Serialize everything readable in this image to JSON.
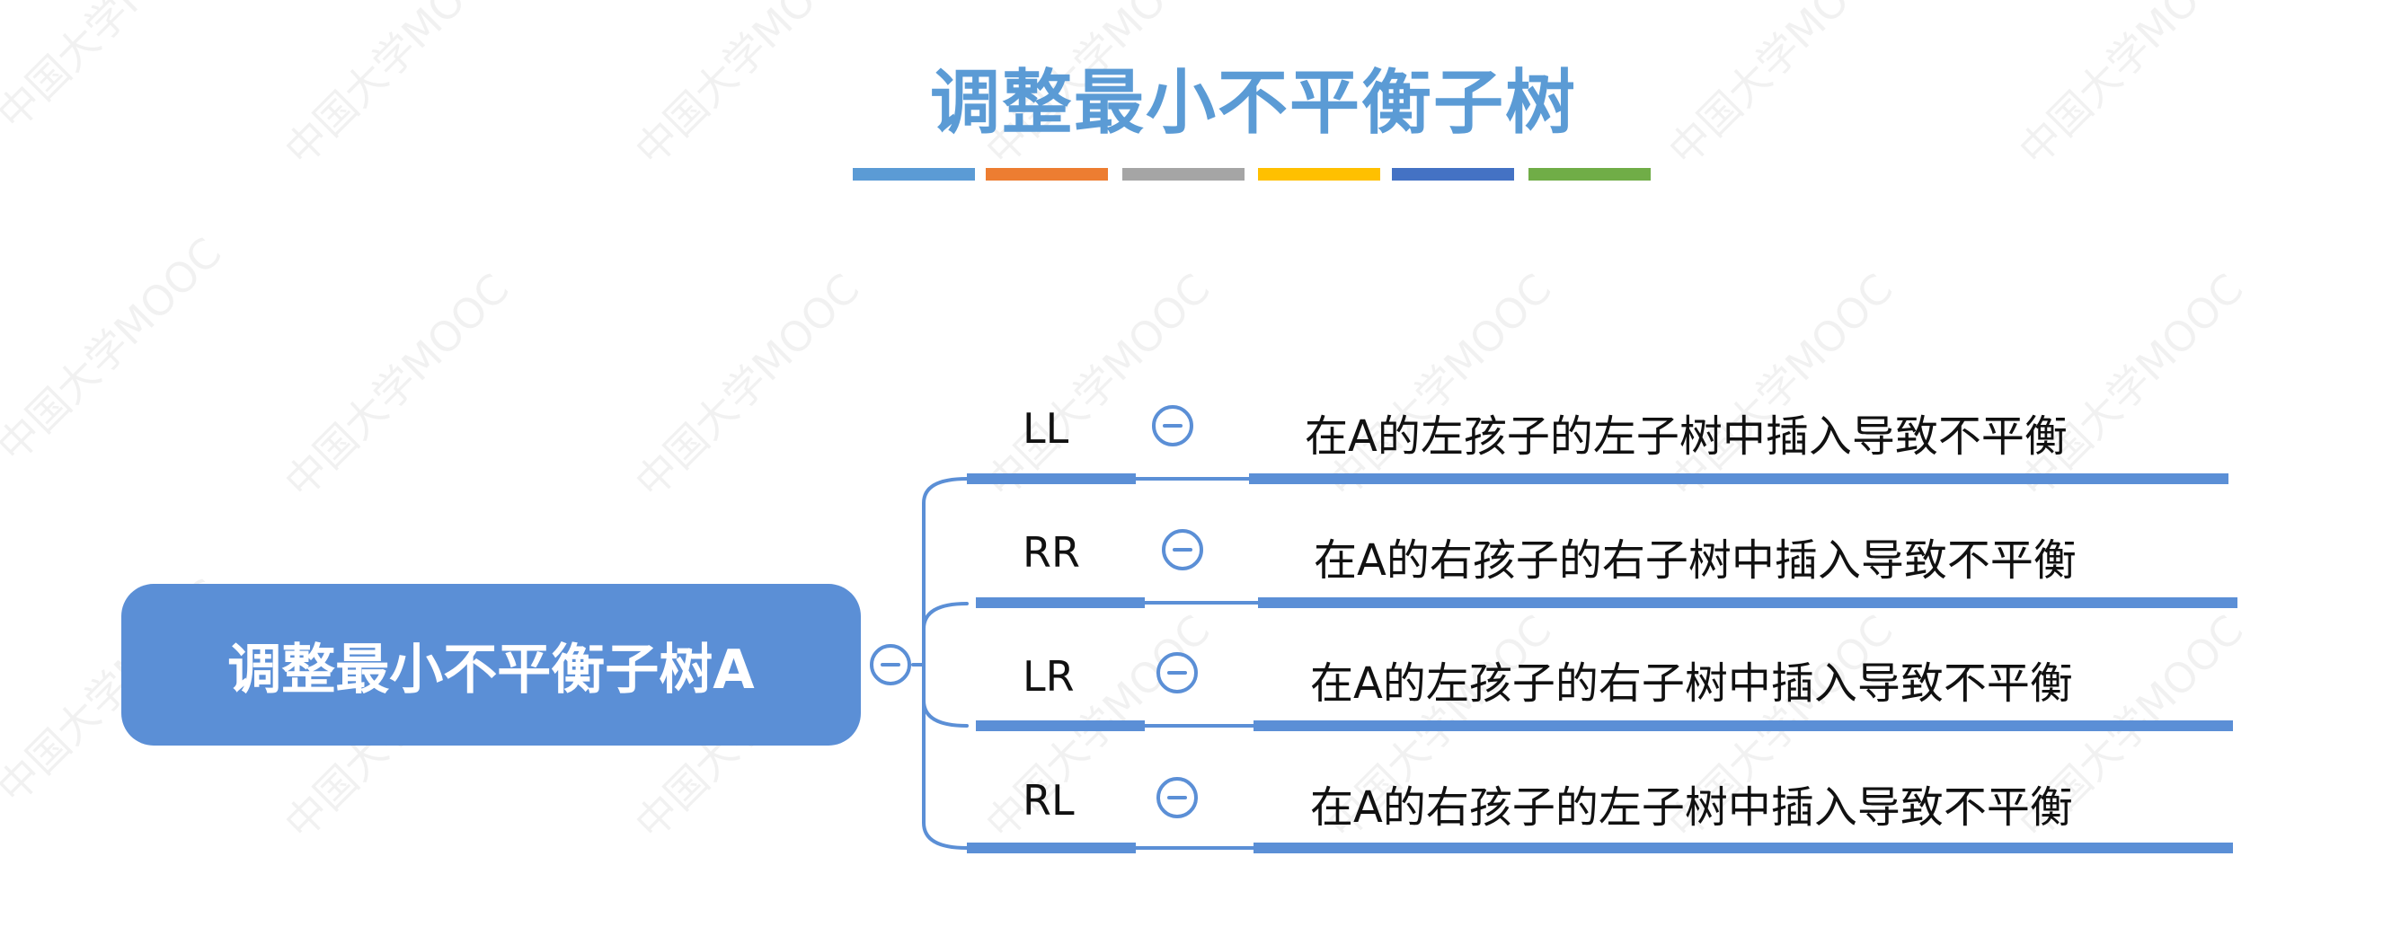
{
  "title": "调整最小不平衡子树",
  "watermark": "中国大学MOOC",
  "palette": [
    "#5b9bd5",
    "#ed7d31",
    "#a5a5a5",
    "#ffc000",
    "#4472c4",
    "#70ad47"
  ],
  "root": {
    "label": "调整最小不平衡子树A"
  },
  "branches": [
    {
      "label": "LL",
      "description": "在A的左孩子的左子树中插入导致不平衡"
    },
    {
      "label": "RR",
      "description": "在A的右孩子的右子树中插入导致不平衡"
    },
    {
      "label": "LR",
      "description": "在A的左孩子的右子树中插入导致不平衡"
    },
    {
      "label": "RL",
      "description": "在A的右孩子的左子树中插入导致不平衡"
    }
  ]
}
